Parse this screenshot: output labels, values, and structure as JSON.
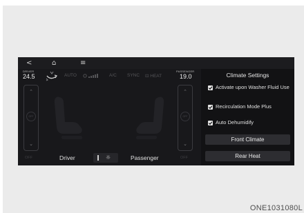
{
  "nav": {
    "back_icon": "<",
    "home_icon": "⌂",
    "menu_icon": "≡"
  },
  "driver": {
    "label": "DRIVER",
    "temp": "24.5",
    "zone": "Driver",
    "off": "OFF",
    "knob": "OFF"
  },
  "passenger": {
    "label": "PASSENGER",
    "temp": "19.0",
    "zone": "Passenger",
    "off": "OFF",
    "knob": "OFF"
  },
  "toggles": [
    "AUTO",
    "A/C",
    "SYNC",
    "HEAT"
  ],
  "settings": {
    "title": "Climate Settings",
    "options": [
      {
        "label": "Activate upon Washer Fluid Use",
        "checked": true
      },
      {
        "label": "Recirculation Mode Plus",
        "checked": true
      },
      {
        "label": "Auto Dehumidify",
        "checked": true
      }
    ],
    "buttons": [
      "Front Climate",
      "Rear Heat"
    ]
  },
  "figure_code": "ONE1031080L"
}
